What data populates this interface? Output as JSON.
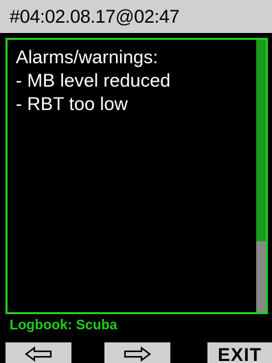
{
  "header": {
    "title": "#04:02.08.17@02:47"
  },
  "content": {
    "lines": [
      "Alarms/warnings:",
      "- MB level reduced",
      "- RBT too low"
    ]
  },
  "scrollbar": {
    "position_fraction": 0.74
  },
  "footer": {
    "label": "Logbook: Scuba"
  },
  "softkeys": {
    "left_icon": "arrow-left-icon",
    "middle_icon": "arrow-right-icon",
    "right_label": "EXIT"
  },
  "colors": {
    "accent_green": "#1fcc1f",
    "dark_green": "#1a9a1a",
    "bar_grey": "#d0d0d0",
    "track_grey": "#888888",
    "background": "#000000"
  }
}
